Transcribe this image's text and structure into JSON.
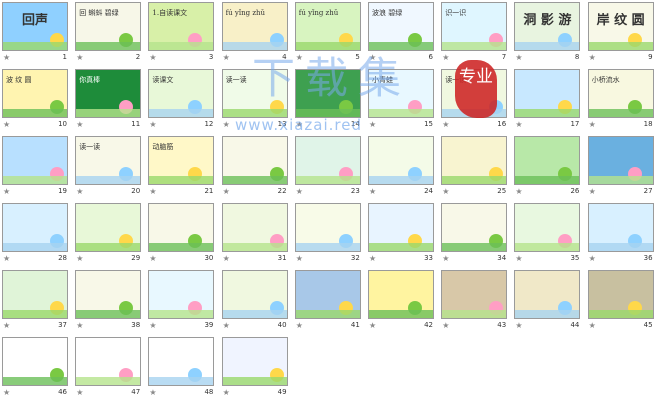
{
  "watermark": {
    "main": "下载集",
    "seal": "专业",
    "url": "www.xiazai.red"
  },
  "slides": [
    {
      "n": "1",
      "t": "回声",
      "bg": "#8fd0ff",
      "big": true
    },
    {
      "n": "2",
      "t": "回 蝌蚪 碧绿",
      "bg": "#f7f7e8"
    },
    {
      "n": "3",
      "t": "1.自读课文",
      "bg": "#d8f0a8"
    },
    {
      "n": "4",
      "t": "fú yǐng zhǔ",
      "bg": "#f8f0c8"
    },
    {
      "n": "5",
      "t": "fú yǐng zhǔ",
      "bg": "#d8f4c0"
    },
    {
      "n": "6",
      "t": "波浪 碧绿",
      "bg": "#f0f8ff"
    },
    {
      "n": "7",
      "t": "识一识",
      "bg": "#dff6ff"
    },
    {
      "n": "8",
      "t": "洞 影 游",
      "bg": "#e8f4e0",
      "big": true
    },
    {
      "n": "9",
      "t": "岸 纹 圆",
      "bg": "#f8f8e8",
      "big": true
    },
    {
      "n": "10",
      "t": "波 纹 圆",
      "bg": "#fff4b0"
    },
    {
      "n": "11",
      "t": "你真棒",
      "bg": "#1e8c3a"
    },
    {
      "n": "12",
      "t": "读课文",
      "bg": "#e8f8d8"
    },
    {
      "n": "13",
      "t": "读一读",
      "bg": "#f0fbe8"
    },
    {
      "n": "14",
      "t": "",
      "bg": "#3ea050"
    },
    {
      "n": "15",
      "t": "小青蛙",
      "bg": "#e8f8ff"
    },
    {
      "n": "16",
      "t": "读一读",
      "bg": "#f0f8e0"
    },
    {
      "n": "17",
      "t": "",
      "bg": "#c8e8ff"
    },
    {
      "n": "18",
      "t": "小桥流水",
      "bg": "#f8f8e0"
    },
    {
      "n": "19",
      "t": "",
      "bg": "#b8e0ff"
    },
    {
      "n": "20",
      "t": "读一读",
      "bg": "#f8f8e8"
    },
    {
      "n": "21",
      "t": "动脑筋",
      "bg": "#fff8c8"
    },
    {
      "n": "22",
      "t": "",
      "bg": "#f8f8e8"
    },
    {
      "n": "23",
      "t": "",
      "bg": "#e0f4e8"
    },
    {
      "n": "24",
      "t": "",
      "bg": "#f4fbe8"
    },
    {
      "n": "25",
      "t": "",
      "bg": "#f8f4d0"
    },
    {
      "n": "26",
      "t": "",
      "bg": "#b8e8a8"
    },
    {
      "n": "27",
      "t": "",
      "bg": "#6ab0e0"
    },
    {
      "n": "28",
      "t": "",
      "bg": "#d8f0ff"
    },
    {
      "n": "29",
      "t": "",
      "bg": "#e8f8d8"
    },
    {
      "n": "30",
      "t": "",
      "bg": "#f8f8e8"
    },
    {
      "n": "31",
      "t": "",
      "bg": "#f0f8e0"
    },
    {
      "n": "32",
      "t": "",
      "bg": "#f8fbe8"
    },
    {
      "n": "33",
      "t": "",
      "bg": "#e8f4ff"
    },
    {
      "n": "34",
      "t": "",
      "bg": "#f8f8e8"
    },
    {
      "n": "35",
      "t": "",
      "bg": "#e8f8e0"
    },
    {
      "n": "36",
      "t": "",
      "bg": "#d8f0ff"
    },
    {
      "n": "37",
      "t": "",
      "bg": "#e0f4d8"
    },
    {
      "n": "38",
      "t": "",
      "bg": "#f8f8e8"
    },
    {
      "n": "39",
      "t": "",
      "bg": "#e8f8ff"
    },
    {
      "n": "40",
      "t": "",
      "bg": "#f0f8e0"
    },
    {
      "n": "41",
      "t": "",
      "bg": "#a8c8e8"
    },
    {
      "n": "42",
      "t": "",
      "bg": "#fff4a0"
    },
    {
      "n": "43",
      "t": "",
      "bg": "#d8c8a8"
    },
    {
      "n": "44",
      "t": "",
      "bg": "#f0e8c8"
    },
    {
      "n": "45",
      "t": "",
      "bg": "#c8c0a0"
    },
    {
      "n": "46",
      "t": "",
      "bg": "#ffffff"
    },
    {
      "n": "47",
      "t": "",
      "bg": "#ffffff"
    },
    {
      "n": "48",
      "t": "",
      "bg": "#ffffff"
    },
    {
      "n": "49",
      "t": "",
      "bg": "#f0f4ff"
    }
  ],
  "star_icon": "★"
}
